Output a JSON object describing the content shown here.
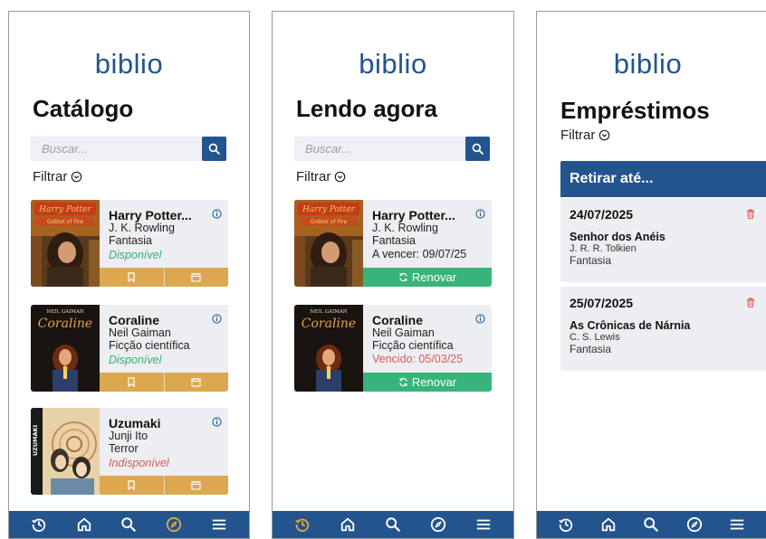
{
  "brand": "biblio",
  "colors": {
    "primary": "#24548e",
    "action_orange": "#dca84f",
    "renew_green": "#38b47a",
    "available_green": "#35b274",
    "alert_red": "#dc5a5a",
    "card_bg": "#eceef2",
    "nav_active": "#e6a83c"
  },
  "catalog": {
    "title": "Catálogo",
    "search_placeholder": "Buscar...",
    "filter_label": "Filtrar",
    "books": [
      {
        "title": "Harry Potter...",
        "author": "J. K. Rowling",
        "genre": "Fantasia",
        "status": "Disponível",
        "cover_icon": "harry-potter-cover"
      },
      {
        "title": "Coraline",
        "author": "Neil Gaiman",
        "genre": "Ficção científica",
        "status": "Disponível",
        "cover_icon": "coraline-cover",
        "cover_author": "NEIL GAIMAN",
        "cover_title": "Coraline"
      },
      {
        "title": "Uzumaki",
        "author": "Junji Ito",
        "genre": "Terror",
        "status": "Indisponível",
        "cover_icon": "uzumaki-cover",
        "cover_spine": "UZUMAKI"
      }
    ]
  },
  "reading": {
    "title": "Lendo agora",
    "search_placeholder": "Buscar...",
    "filter_label": "Filtrar",
    "books": [
      {
        "title": "Harry Potter...",
        "author": "J. K. Rowling",
        "genre": "Fantasia",
        "due": "A vencer: 09/07/25",
        "renew_label": "Renovar"
      },
      {
        "title": "Coraline",
        "author": "Neil Gaiman",
        "genre": "Ficção científica",
        "due": "Vencido: 05/03/25",
        "renew_label": "Renovar"
      }
    ]
  },
  "loans": {
    "title": "Empréstimos",
    "filter_label": "Filtrar",
    "header": "Retirar até...",
    "items": [
      {
        "date": "24/07/2025",
        "title": "Senhor dos Anéis",
        "author": "J. R. R. Tolkien",
        "genre": "Fantasia"
      },
      {
        "date": "25/07/2025",
        "title": "As Crônicas de Nárnia",
        "author": "C. S. Lewis",
        "genre": "Fantasia"
      }
    ]
  },
  "nav": {
    "items": [
      "history-icon",
      "home-icon",
      "search-icon",
      "explore-icon",
      "menu-icon"
    ],
    "active_screen1": "explore-icon",
    "active_screen2": "history-icon",
    "active_screen3": "none"
  }
}
